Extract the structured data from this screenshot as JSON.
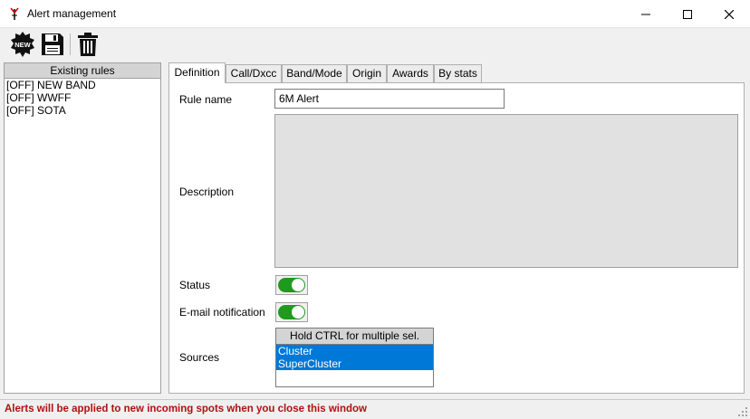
{
  "window": {
    "title": "Alert management"
  },
  "toolbar": {
    "new_badge": "NEW"
  },
  "rules_panel": {
    "header": "Existing rules",
    "items": [
      "[OFF] NEW BAND",
      "[OFF] WWFF",
      "[OFF] SOTA"
    ]
  },
  "tabs": [
    "Definition",
    "Call/Dxcc",
    "Band/Mode",
    "Origin",
    "Awards",
    "By stats"
  ],
  "form": {
    "rule_name_label": "Rule name",
    "rule_name_value": "6M Alert",
    "description_label": "Description",
    "description_value": "",
    "status_label": "Status",
    "status_on": true,
    "email_label": "E-mail notification",
    "email_on": true,
    "sources_label": "Sources",
    "sources_header": "Hold CTRL for multiple sel.",
    "sources_selected": [
      "Cluster",
      "SuperCluster"
    ]
  },
  "statusbar": {
    "message": "Alerts will be applied to new incoming spots when you close this window"
  },
  "colors": {
    "toggle_on": "#1f9a1f",
    "selection": "#0078d7",
    "status_text": "#b01010"
  }
}
